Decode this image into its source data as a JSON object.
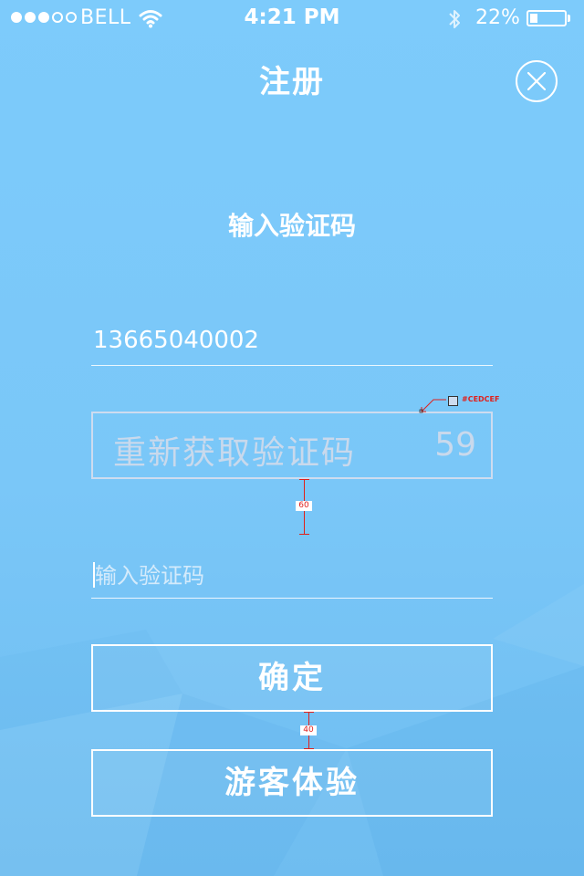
{
  "status_bar": {
    "carrier": "BELL",
    "time": "4:21 PM",
    "battery_percent": "22%",
    "battery_level": 0.22,
    "signal_bars_filled": 3,
    "signal_bars_total": 5,
    "icons": [
      "signal-dots-icon",
      "wifi-icon",
      "bluetooth-icon",
      "battery-icon"
    ]
  },
  "nav": {
    "title": "注册",
    "close_icon": "close-circle-icon"
  },
  "form": {
    "heading": "输入验证码",
    "phone_number": "13665040002",
    "resend_label": "重新获取验证码",
    "countdown": "59",
    "code_input_placeholder": "输入验证码",
    "code_input_value": ""
  },
  "buttons": {
    "confirm": "确定",
    "guest": "游客体验"
  },
  "annotations": {
    "border_color_label": "#CEDCEF",
    "spacing_resend_to_input": "60",
    "spacing_between_buttons": "40"
  },
  "colors": {
    "background": "#7dcbfb",
    "resend_border": "#cedcef",
    "annotation": "#e0201c",
    "text": "#ffffff"
  }
}
